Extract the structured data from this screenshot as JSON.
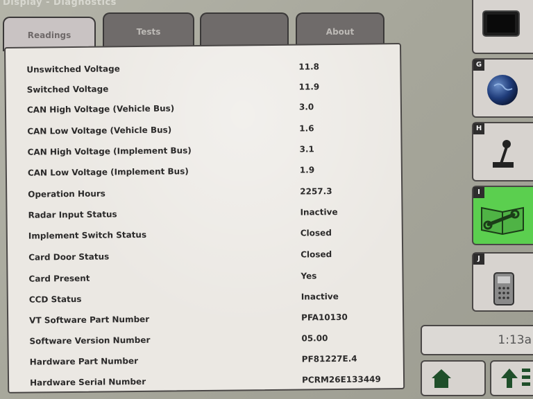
{
  "window": {
    "title": "Display - Diagnostics"
  },
  "tabs": [
    {
      "label": "Readings",
      "active": true
    },
    {
      "label": "Tests",
      "active": false
    },
    {
      "label": "",
      "active": false
    },
    {
      "label": "About",
      "active": false
    }
  ],
  "readings": [
    {
      "label": "Unswitched Voltage",
      "value": "11.8"
    },
    {
      "label": "Switched Voltage",
      "value": "11.9"
    },
    {
      "label": "CAN High Voltage (Vehicle Bus)",
      "value": "3.0"
    },
    {
      "label": "CAN Low Voltage (Vehicle Bus)",
      "value": "1.6"
    },
    {
      "label": "CAN High Voltage (Implement Bus)",
      "value": "3.1"
    },
    {
      "label": "CAN Low Voltage (Implement Bus)",
      "value": "1.9"
    },
    {
      "label": "Operation Hours",
      "value": "2257.3"
    },
    {
      "label": "Radar Input Status",
      "value": "Inactive"
    },
    {
      "label": "Implement Switch Status",
      "value": "Closed"
    },
    {
      "label": "Card Door Status",
      "value": "Closed"
    },
    {
      "label": "Card Present",
      "value": "Yes"
    },
    {
      "label": "CCD Status",
      "value": "Inactive"
    },
    {
      "label": "VT Software Part Number",
      "value": "PFA10130"
    },
    {
      "label": "Software Version Number",
      "value": "05.00"
    },
    {
      "label": "Hardware Part Number",
      "value": "PF81227E.4"
    },
    {
      "label": "Hardware Serial Number",
      "value": "PCRM26E133449"
    }
  ],
  "sidebar": {
    "items": [
      {
        "letter": "",
        "icon": "display-screen-icon"
      },
      {
        "letter": "G",
        "icon": "globe-icon"
      },
      {
        "letter": "H",
        "icon": "joystick-icon"
      },
      {
        "letter": "I",
        "icon": "manual-wrench-icon",
        "active": true
      },
      {
        "letter": "J",
        "icon": "handheld-device-icon"
      }
    ]
  },
  "status": {
    "time": "1:13a"
  },
  "colors": {
    "active_sidebar": "#5bcf4f",
    "panel_background": "#ebe8e3",
    "tab_inactive": "#6f6b6a",
    "bezel": "#a7a79b"
  }
}
